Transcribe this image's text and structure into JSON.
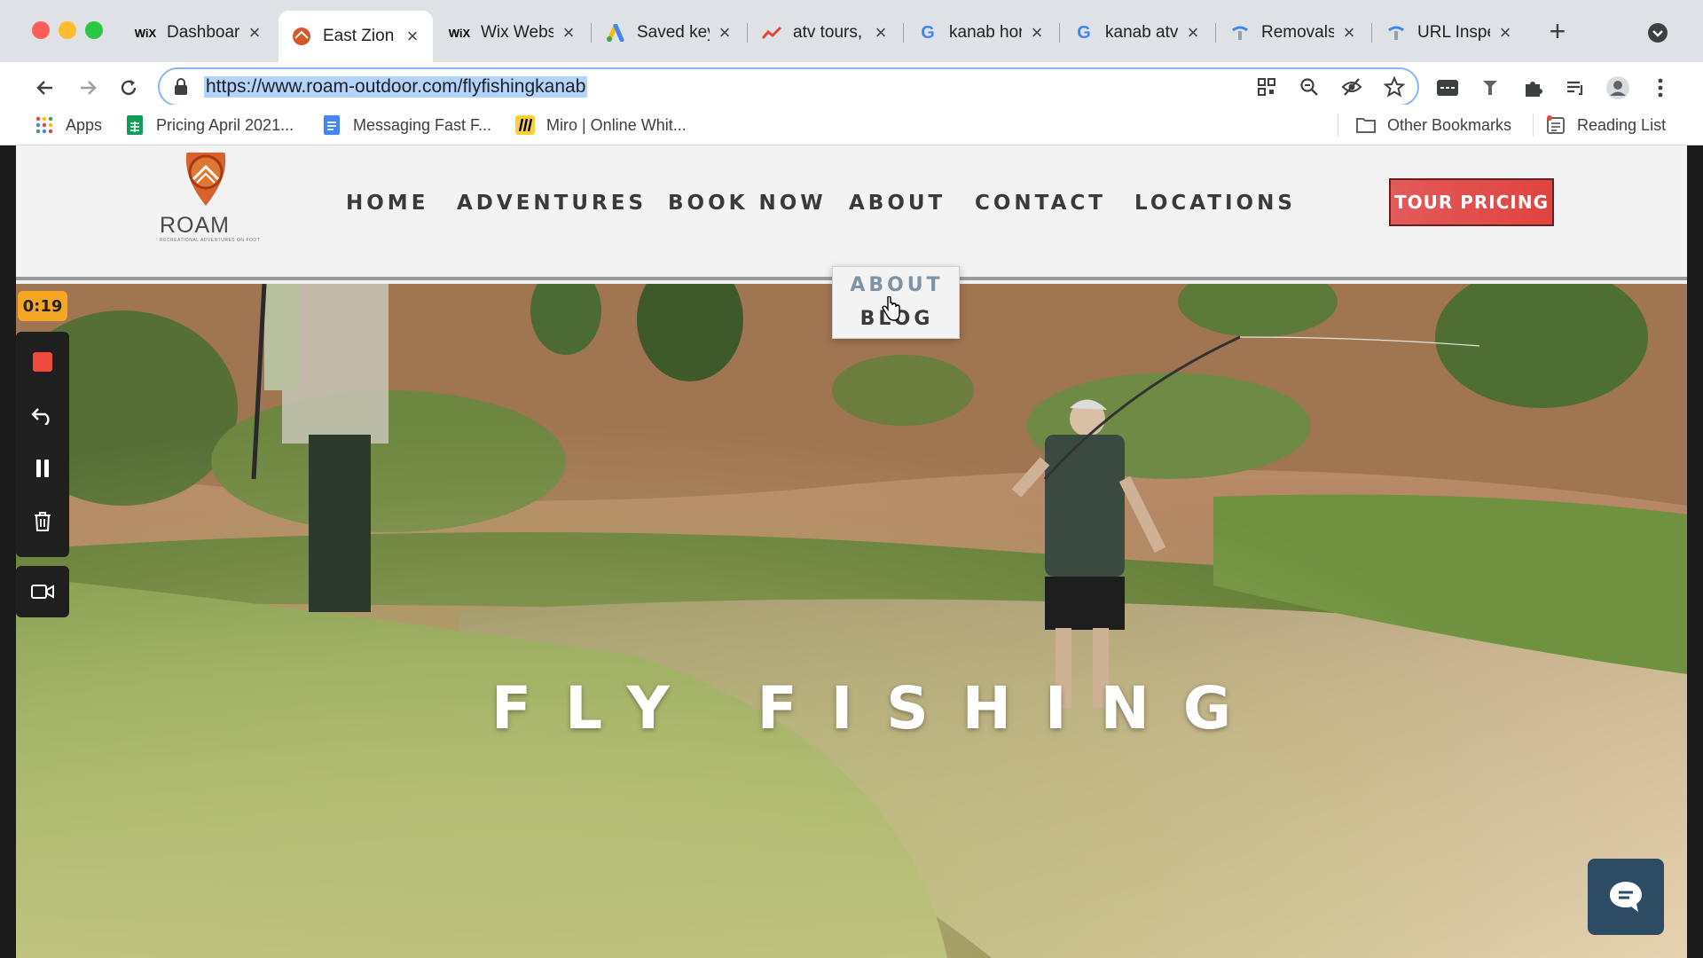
{
  "browser": {
    "tabs": [
      {
        "favicon": "wix-icon",
        "title": "Dashboar",
        "active": false
      },
      {
        "favicon": "roam-icon",
        "title": "East Zion",
        "active": true
      },
      {
        "favicon": "wix-icon",
        "title": "Wix Webs",
        "active": false
      },
      {
        "favicon": "google-ads-icon",
        "title": "Saved key",
        "active": false
      },
      {
        "favicon": "trends-icon",
        "title": "atv tours,",
        "active": false
      },
      {
        "favicon": "google-icon",
        "title": "kanab hor",
        "active": false
      },
      {
        "favicon": "google-icon",
        "title": "kanab atv",
        "active": false
      },
      {
        "favicon": "search-console-icon",
        "title": "Removals",
        "active": false
      },
      {
        "favicon": "search-console-icon",
        "title": "URL Inspe",
        "active": false
      }
    ],
    "favicon_text": {
      "wix": "WiX",
      "google": "G"
    },
    "url": "https://www.roam-outdoor.com/flyfishingkanab",
    "bookmarks": [
      {
        "icon": "apps-grid-icon",
        "label": "Apps"
      },
      {
        "icon": "sheets-icon",
        "label": "Pricing April 2021..."
      },
      {
        "icon": "docs-icon",
        "label": "Messaging Fast F..."
      },
      {
        "icon": "miro-icon",
        "label": "Miro | Online Whit..."
      }
    ],
    "other_bookmarks": "Other Bookmarks",
    "reading_list": "Reading List"
  },
  "site": {
    "logo_text": "ROAM",
    "logo_tagline": "RECREATIONAL ADVENTURES ON FOOT",
    "nav": [
      "HOME",
      "ADVENTURES",
      "BOOK NOW",
      "ABOUT",
      "CONTACT",
      "LOCATIONS"
    ],
    "cta": "TOUR PRICING",
    "dropdown": [
      "ABOUT",
      "BLOG"
    ],
    "hero_title": "FLY FISHING"
  },
  "recorder": {
    "timer": "0:19"
  },
  "colors": {
    "cta_red": "#e0433e",
    "nav_text": "#3a3a3a",
    "dropdown_about": "#7f93a6",
    "chat_bg": "#2d4b63",
    "timer_bg": "#f5a623"
  }
}
